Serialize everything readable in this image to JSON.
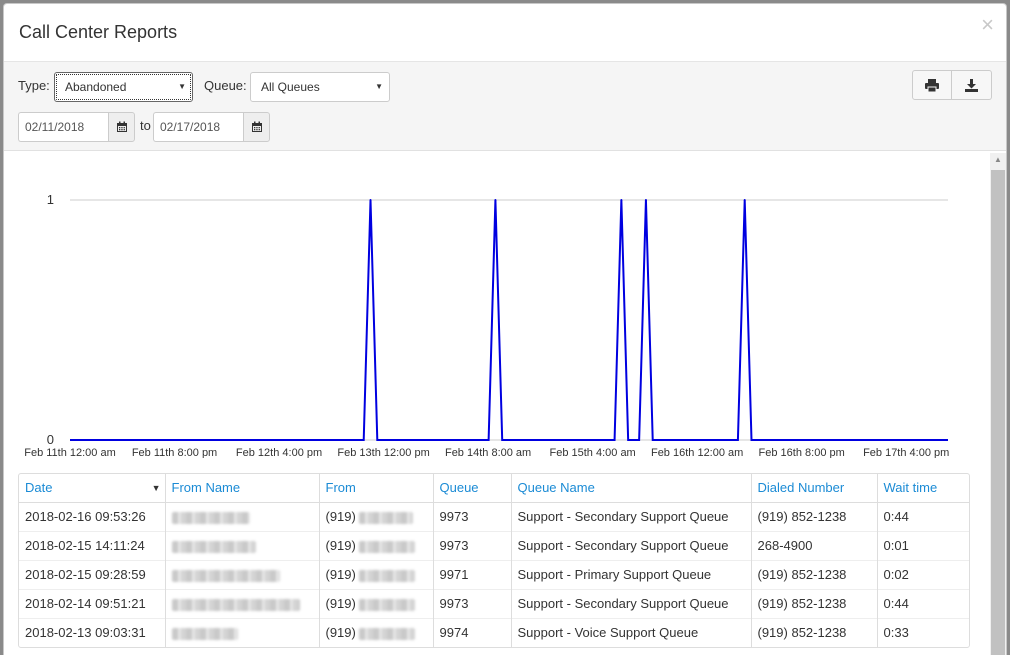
{
  "title": "Call Center Reports",
  "close_glyph": "×",
  "filters": {
    "type_label": "Type:",
    "type_value": "Abandoned",
    "queue_label": "Queue:",
    "queue_value": "All Queues",
    "start_date": "02/11/2018",
    "to_label": "to",
    "end_date": "02/17/2018"
  },
  "icons": {
    "print": "print-icon",
    "download": "download-icon",
    "calendar": "calendar-icon",
    "close": "close-icon"
  },
  "chart_data": {
    "type": "line",
    "x_tick_labels": [
      "Feb 11th 12:00 am",
      "Feb 11th 8:00 pm",
      "Feb 12th 4:00 pm",
      "Feb 13th 12:00 pm",
      "Feb 14th 8:00 am",
      "Feb 15th 4:00 am",
      "Feb 16th 12:00 am",
      "Feb 16th 8:00 pm",
      "Feb 17th 4:00 pm"
    ],
    "x_tick_hours": [
      0,
      20,
      40,
      60,
      80,
      100,
      120,
      140,
      160
    ],
    "y_ticks": [
      0,
      1
    ],
    "xlim_hours": [
      0,
      168
    ],
    "ylim": [
      0,
      1
    ],
    "series_color": "#0000e0",
    "spike_hours": [
      57.5,
      81.4,
      105.5,
      110.2,
      129.1
    ],
    "spike_values": [
      1,
      1,
      1,
      1,
      1
    ],
    "grid": "horizontal"
  },
  "table": {
    "columns": [
      "Date",
      "From Name",
      "From",
      "Queue",
      "Queue Name",
      "Dialed Number",
      "Wait time"
    ],
    "rows": [
      {
        "date": "2018-02-16 09:53:26",
        "from_prefix": "(919)",
        "queue": "9973",
        "queue_name": "Support - Secondary Support Queue",
        "dialed": "(919) 852-1238",
        "wait": "0:44"
      },
      {
        "date": "2018-02-15 14:11:24",
        "from_prefix": "(919)",
        "queue": "9973",
        "queue_name": "Support - Secondary Support Queue",
        "dialed": "268-4900",
        "wait": "0:01"
      },
      {
        "date": "2018-02-15 09:28:59",
        "from_prefix": "(919)",
        "queue": "9971",
        "queue_name": "Support - Primary Support Queue",
        "dialed": "(919) 852-1238",
        "wait": "0:02"
      },
      {
        "date": "2018-02-14 09:51:21",
        "from_prefix": "(919)",
        "queue": "9973",
        "queue_name": "Support - Secondary Support Queue",
        "dialed": "(919) 852-1238",
        "wait": "0:44"
      },
      {
        "date": "2018-02-13 09:03:31",
        "from_prefix": "(919)",
        "queue": "9974",
        "queue_name": "Support - Voice Support Queue",
        "dialed": "(919) 852-1238",
        "wait": "0:33"
      }
    ]
  }
}
